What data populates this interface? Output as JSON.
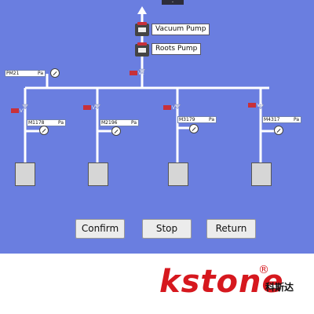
{
  "header": {
    "collapse_glyph": "⌄"
  },
  "pumps": {
    "vacuum_label": "Vacuum Pump",
    "roots_label": "Roots Pump"
  },
  "main_valve": {
    "tag": "V2"
  },
  "main_sensor": {
    "name": "PM21",
    "unit": "Pa"
  },
  "branches": [
    {
      "valve": "V1",
      "sensor": "M1",
      "value": "178",
      "unit": "Pa"
    },
    {
      "valve": "V2",
      "sensor": "M2",
      "value": "196",
      "unit": "Pa"
    },
    {
      "valve": "V3",
      "sensor": "M3",
      "value": "179",
      "unit": "Pa"
    },
    {
      "valve": "V4",
      "sensor": "M4",
      "value": "317",
      "unit": "Pa"
    }
  ],
  "buttons": {
    "confirm": "Confirm",
    "stop": "Stop",
    "return": "Return"
  },
  "brand": {
    "name": "kstone",
    "registered": "®",
    "chinese": "科斯达"
  },
  "colors": {
    "panel": "#6a7ee0",
    "pipe": "#ffffff",
    "brand_red": "#d6181e"
  }
}
